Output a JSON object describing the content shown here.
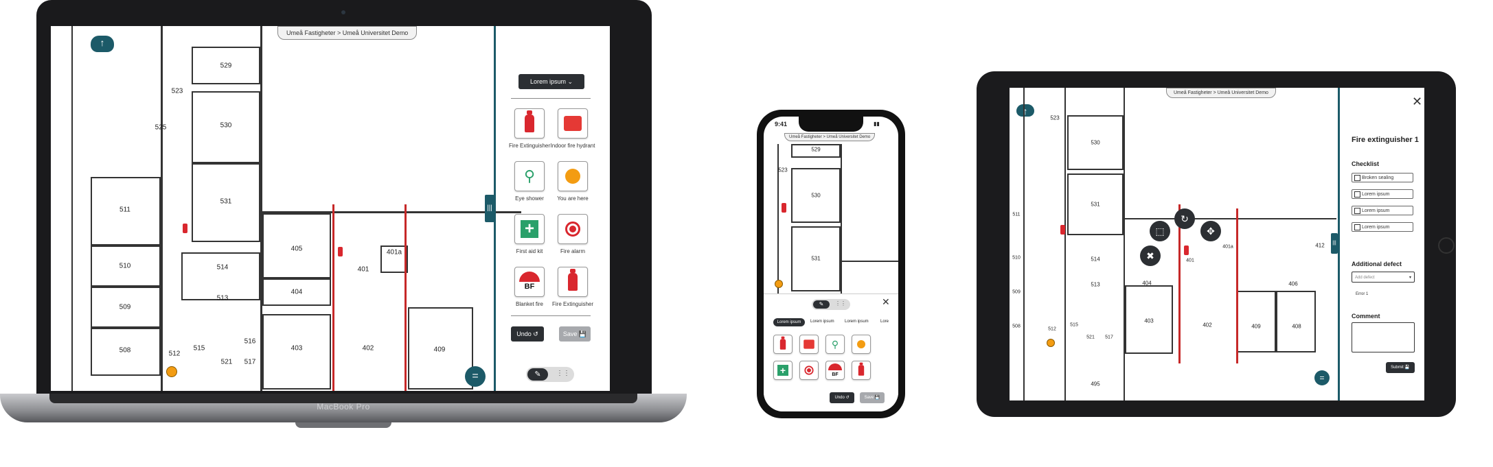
{
  "breadcrumb": "Umeå Fastigheter > Umeå Universitet Demo",
  "laptop": {
    "brand": "MacBook Pro",
    "dropdown": "Lorem ipsum",
    "tiles": [
      {
        "label": "Fire Extinguisher",
        "icon": "fire-extinguisher-icon"
      },
      {
        "label": "Indoor fire hydrant",
        "icon": "fire-hydrant-icon"
      },
      {
        "label": "Eye shower",
        "icon": "eye-shower-icon"
      },
      {
        "label": "You are here",
        "icon": "you-are-here-icon"
      },
      {
        "label": "First aid kit",
        "icon": "first-aid-icon"
      },
      {
        "label": "Fire alarm",
        "icon": "fire-alarm-icon"
      },
      {
        "label": "Blanket fire",
        "icon": "fire-blanket-icon"
      },
      {
        "label": "Fire Extinguisher",
        "icon": "fire-extinguisher-icon"
      }
    ],
    "undo": "Undo ↺",
    "save": "Save 💾",
    "rooms": [
      "529",
      "523",
      "525",
      "530",
      "531",
      "511",
      "510",
      "509",
      "508",
      "512",
      "515",
      "514",
      "513",
      "516",
      "517",
      "521",
      "405",
      "404",
      "403",
      "401",
      "401a",
      "402",
      "409"
    ]
  },
  "phone": {
    "time": "9:41",
    "tabs": [
      "Lorem ipsum",
      "Lorem ipsum",
      "Lorem ipsum",
      "Lore"
    ],
    "undo": "Undo ↺",
    "save": "Save 💾",
    "bf": "BF",
    "rooms": [
      "529",
      "523",
      "530",
      "531"
    ]
  },
  "tablet": {
    "panel_title": "Fire extinguisher 1",
    "checklist_title": "Checklist",
    "checklist": [
      "Broken sealing",
      "Lorem ipsum",
      "Lorem ipsum",
      "Lorem ipsum"
    ],
    "defect_title": "Additional defect",
    "defect_placeholder": "Add defect",
    "error": "Error 1",
    "comment_title": "Comment",
    "submit": "Submit 💾",
    "rooms": [
      "523",
      "530",
      "531",
      "511",
      "510",
      "509",
      "508",
      "512",
      "515",
      "521",
      "517",
      "514",
      "513",
      "495",
      "404",
      "403",
      "401",
      "401a",
      "402",
      "409",
      "406",
      "408",
      "412"
    ]
  },
  "colors": {
    "accent": "#1c5a68",
    "alert": "#d9272e",
    "dark": "#2c2f33"
  }
}
